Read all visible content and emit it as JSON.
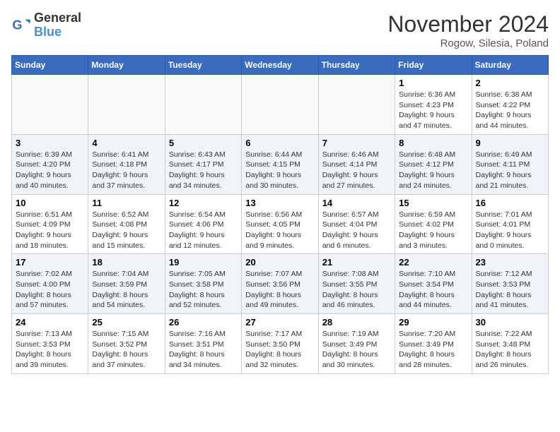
{
  "header": {
    "logo_line1": "General",
    "logo_line2": "Blue",
    "month_title": "November 2024",
    "location": "Rogow, Silesia, Poland"
  },
  "weekdays": [
    "Sunday",
    "Monday",
    "Tuesday",
    "Wednesday",
    "Thursday",
    "Friday",
    "Saturday"
  ],
  "weeks": [
    [
      {
        "day": "",
        "info": ""
      },
      {
        "day": "",
        "info": ""
      },
      {
        "day": "",
        "info": ""
      },
      {
        "day": "",
        "info": ""
      },
      {
        "day": "",
        "info": ""
      },
      {
        "day": "1",
        "info": "Sunrise: 6:36 AM\nSunset: 4:23 PM\nDaylight: 9 hours and 47 minutes."
      },
      {
        "day": "2",
        "info": "Sunrise: 6:38 AM\nSunset: 4:22 PM\nDaylight: 9 hours and 44 minutes."
      }
    ],
    [
      {
        "day": "3",
        "info": "Sunrise: 6:39 AM\nSunset: 4:20 PM\nDaylight: 9 hours and 40 minutes."
      },
      {
        "day": "4",
        "info": "Sunrise: 6:41 AM\nSunset: 4:18 PM\nDaylight: 9 hours and 37 minutes."
      },
      {
        "day": "5",
        "info": "Sunrise: 6:43 AM\nSunset: 4:17 PM\nDaylight: 9 hours and 34 minutes."
      },
      {
        "day": "6",
        "info": "Sunrise: 6:44 AM\nSunset: 4:15 PM\nDaylight: 9 hours and 30 minutes."
      },
      {
        "day": "7",
        "info": "Sunrise: 6:46 AM\nSunset: 4:14 PM\nDaylight: 9 hours and 27 minutes."
      },
      {
        "day": "8",
        "info": "Sunrise: 6:48 AM\nSunset: 4:12 PM\nDaylight: 9 hours and 24 minutes."
      },
      {
        "day": "9",
        "info": "Sunrise: 6:49 AM\nSunset: 4:11 PM\nDaylight: 9 hours and 21 minutes."
      }
    ],
    [
      {
        "day": "10",
        "info": "Sunrise: 6:51 AM\nSunset: 4:09 PM\nDaylight: 9 hours and 18 minutes."
      },
      {
        "day": "11",
        "info": "Sunrise: 6:52 AM\nSunset: 4:08 PM\nDaylight: 9 hours and 15 minutes."
      },
      {
        "day": "12",
        "info": "Sunrise: 6:54 AM\nSunset: 4:06 PM\nDaylight: 9 hours and 12 minutes."
      },
      {
        "day": "13",
        "info": "Sunrise: 6:56 AM\nSunset: 4:05 PM\nDaylight: 9 hours and 9 minutes."
      },
      {
        "day": "14",
        "info": "Sunrise: 6:57 AM\nSunset: 4:04 PM\nDaylight: 9 hours and 6 minutes."
      },
      {
        "day": "15",
        "info": "Sunrise: 6:59 AM\nSunset: 4:02 PM\nDaylight: 9 hours and 3 minutes."
      },
      {
        "day": "16",
        "info": "Sunrise: 7:01 AM\nSunset: 4:01 PM\nDaylight: 9 hours and 0 minutes."
      }
    ],
    [
      {
        "day": "17",
        "info": "Sunrise: 7:02 AM\nSunset: 4:00 PM\nDaylight: 8 hours and 57 minutes."
      },
      {
        "day": "18",
        "info": "Sunrise: 7:04 AM\nSunset: 3:59 PM\nDaylight: 8 hours and 54 minutes."
      },
      {
        "day": "19",
        "info": "Sunrise: 7:05 AM\nSunset: 3:58 PM\nDaylight: 8 hours and 52 minutes."
      },
      {
        "day": "20",
        "info": "Sunrise: 7:07 AM\nSunset: 3:56 PM\nDaylight: 8 hours and 49 minutes."
      },
      {
        "day": "21",
        "info": "Sunrise: 7:08 AM\nSunset: 3:55 PM\nDaylight: 8 hours and 46 minutes."
      },
      {
        "day": "22",
        "info": "Sunrise: 7:10 AM\nSunset: 3:54 PM\nDaylight: 8 hours and 44 minutes."
      },
      {
        "day": "23",
        "info": "Sunrise: 7:12 AM\nSunset: 3:53 PM\nDaylight: 8 hours and 41 minutes."
      }
    ],
    [
      {
        "day": "24",
        "info": "Sunrise: 7:13 AM\nSunset: 3:53 PM\nDaylight: 8 hours and 39 minutes."
      },
      {
        "day": "25",
        "info": "Sunrise: 7:15 AM\nSunset: 3:52 PM\nDaylight: 8 hours and 37 minutes."
      },
      {
        "day": "26",
        "info": "Sunrise: 7:16 AM\nSunset: 3:51 PM\nDaylight: 8 hours and 34 minutes."
      },
      {
        "day": "27",
        "info": "Sunrise: 7:17 AM\nSunset: 3:50 PM\nDaylight: 8 hours and 32 minutes."
      },
      {
        "day": "28",
        "info": "Sunrise: 7:19 AM\nSunset: 3:49 PM\nDaylight: 8 hours and 30 minutes."
      },
      {
        "day": "29",
        "info": "Sunrise: 7:20 AM\nSunset: 3:49 PM\nDaylight: 8 hours and 28 minutes."
      },
      {
        "day": "30",
        "info": "Sunrise: 7:22 AM\nSunset: 3:48 PM\nDaylight: 8 hours and 26 minutes."
      }
    ]
  ]
}
